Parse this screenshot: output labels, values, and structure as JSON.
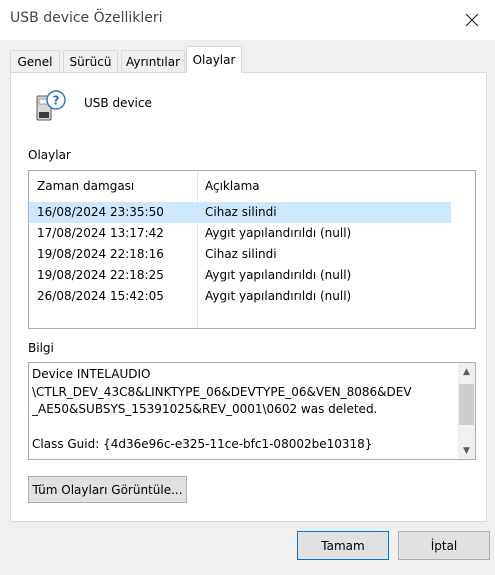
{
  "window": {
    "title": "USB device Özellikleri"
  },
  "tabs": [
    {
      "label": "Genel"
    },
    {
      "label": "Sürücü"
    },
    {
      "label": "Ayrıntılar"
    },
    {
      "label": "Olaylar"
    }
  ],
  "device": {
    "name": "USB device",
    "icon": "usb-device-unknown-icon"
  },
  "events": {
    "section_label": "Olaylar",
    "columns": [
      "Zaman damgası",
      "Açıklama"
    ],
    "rows": [
      {
        "time": "16/08/2024 23:35:50",
        "desc": "Cihaz silindi",
        "selected": true
      },
      {
        "time": "17/08/2024 13:17:42",
        "desc": "Aygıt yapılandırıldı (null)"
      },
      {
        "time": "19/08/2024 22:18:16",
        "desc": "Cihaz silindi"
      },
      {
        "time": "19/08/2024 22:18:25",
        "desc": "Aygıt yapılandırıldı (null)"
      },
      {
        "time": "26/08/2024 15:42:05",
        "desc": "Aygıt yapılandırıldı (null)"
      }
    ]
  },
  "info": {
    "label": "Bilgi",
    "text": "Device INTELAUDIO\n\\CTLR_DEV_43C8&LINKTYPE_06&DEVTYPE_06&VEN_8086&DEV\n_AE50&SUBSYS_15391025&REV_0001\\0602 was deleted.\n\nClass Guid: {4d36e96c-e325-11ce-bfc1-08002be10318}"
  },
  "buttons": {
    "view_all": "Tüm Olayları Görüntüle...",
    "ok": "Tamam",
    "cancel": "İptal"
  },
  "colors": {
    "selection": "#cce8ff",
    "ok_border": "#0078d7"
  }
}
